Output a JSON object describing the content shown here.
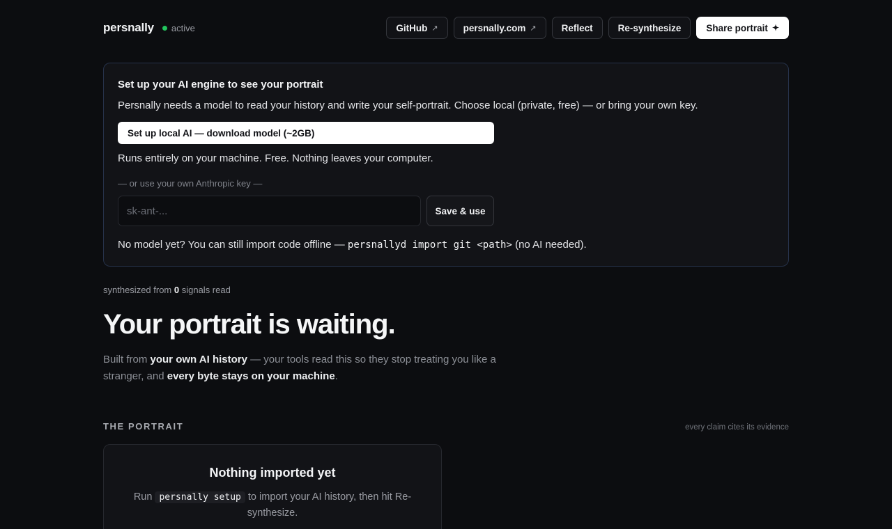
{
  "header": {
    "brand": "persnally",
    "status": "active",
    "status_color": "#22c55e",
    "nav": [
      {
        "label": "GitHub",
        "icon": "external-arrow-icon"
      },
      {
        "label": "persnally.com",
        "icon": "external-arrow-icon"
      },
      {
        "label": "Reflect"
      },
      {
        "label": "Re-synthesize"
      },
      {
        "label": "Share portrait",
        "icon": "sparkle-icon"
      }
    ],
    "arrow_glyph": "↗",
    "spark_glyph": "✦"
  },
  "setup": {
    "title": "Set up your AI engine to see your portrait",
    "description": "Persnally needs a model to read your history and write your self-portrait. Choose local (private, free) — or bring your own key.",
    "local_button": "Set up local AI — download model (~2GB)",
    "local_note": "Runs entirely on your machine. Free. Nothing leaves your computer.",
    "or_line": "— or use your own Anthropic key —",
    "key_placeholder": "sk-ant-...",
    "save_button": "Save & use",
    "offline_prefix": "No model yet? You can still import code offline — ",
    "offline_command": "persnallyd import git <path>",
    "offline_suffix": " (no AI needed)."
  },
  "portrait": {
    "synth_prefix": "synthesized from ",
    "synth_count": "0",
    "synth_suffix": " signals read",
    "headline": "Your portrait is waiting.",
    "lede_1": "Built from ",
    "lede_2": "your own AI history",
    "lede_3": " — your tools read this so they stop treating you like a stranger, and ",
    "lede_4": "every byte stays on your machine",
    "lede_5": "."
  },
  "section": {
    "title": "THE PORTRAIT",
    "note": "every claim cites its evidence"
  },
  "empty": {
    "title": "Nothing imported yet",
    "desc_prefix": "Run ",
    "desc_command": "persnally setup",
    "desc_suffix": " to import your AI history, then hit Re-synthesize."
  }
}
